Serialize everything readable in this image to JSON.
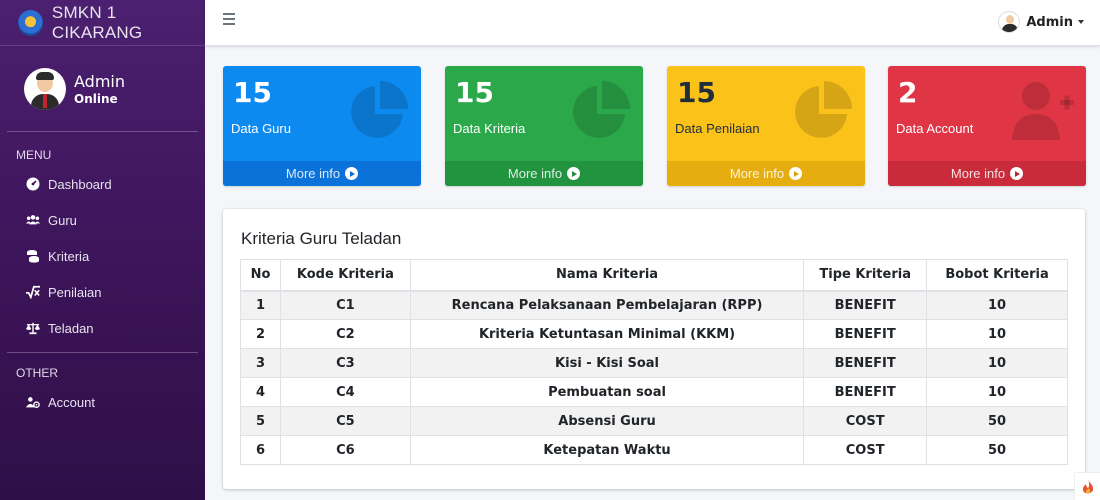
{
  "brand": {
    "title": "SMKN 1 CIKARANG"
  },
  "user": {
    "name": "Admin",
    "status": "Online"
  },
  "sidebar": {
    "menu_header": "MENU",
    "menu_items": [
      {
        "label": "Dashboard",
        "icon": "tachometer-icon"
      },
      {
        "label": "Guru",
        "icon": "users-icon"
      },
      {
        "label": "Kriteria",
        "icon": "coins-icon"
      },
      {
        "label": "Penilaian",
        "icon": "square-root-icon"
      },
      {
        "label": "Teladan",
        "icon": "balance-scale-icon"
      }
    ],
    "other_header": "OTHER",
    "other_items": [
      {
        "label": "Account",
        "icon": "users-cog-icon"
      }
    ]
  },
  "topbar": {
    "admin_label": "Admin"
  },
  "boxes": [
    {
      "value": "15",
      "label": "Data Guru",
      "footer": "More info",
      "color": "#0d8af0",
      "icon": "pie-chart-icon"
    },
    {
      "value": "15",
      "label": "Data Kriteria",
      "footer": "More info",
      "color": "#2aa84a",
      "icon": "pie-chart-icon"
    },
    {
      "value": "15",
      "label": "Data Penilaian",
      "footer": "More info",
      "color": "#fbc21a",
      "icon": "pie-chart-icon"
    },
    {
      "value": "2",
      "label": "Data Account",
      "footer": "More info",
      "color": "#df3545",
      "icon": "user-plus-icon"
    }
  ],
  "table": {
    "title": "Kriteria Guru Teladan",
    "headers": [
      "No",
      "Kode Kriteria",
      "Nama Kriteria",
      "Tipe Kriteria",
      "Bobot Kriteria"
    ],
    "rows": [
      [
        "1",
        "C1",
        "Rencana Pelaksanaan Pembelajaran (RPP)",
        "BENEFIT",
        "10"
      ],
      [
        "2",
        "C2",
        "Kriteria Ketuntasan Minimal (KKM)",
        "BENEFIT",
        "10"
      ],
      [
        "3",
        "C3",
        "Kisi - Kisi Soal",
        "BENEFIT",
        "10"
      ],
      [
        "4",
        "C4",
        "Pembuatan soal",
        "BENEFIT",
        "10"
      ],
      [
        "5",
        "C5",
        "Absensi Guru",
        "COST",
        "50"
      ],
      [
        "6",
        "C6",
        "Ketepatan Waktu",
        "COST",
        "50"
      ]
    ]
  }
}
